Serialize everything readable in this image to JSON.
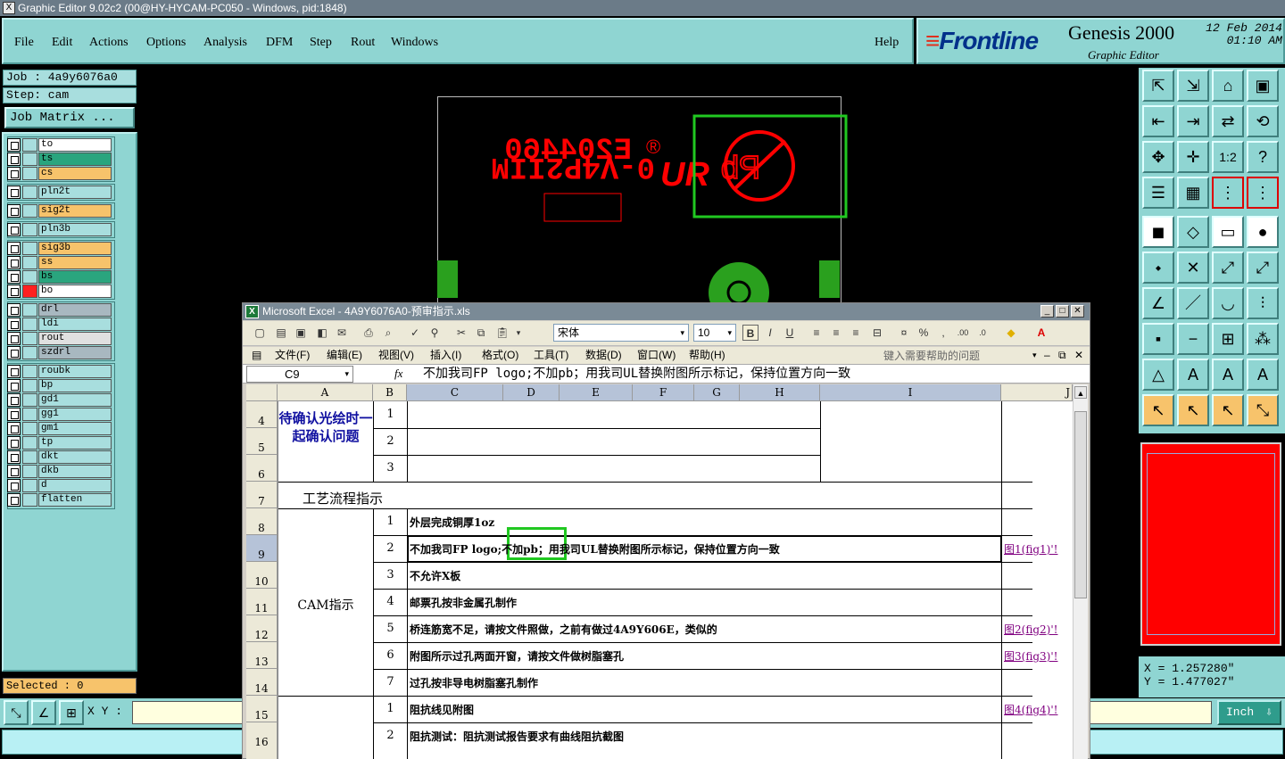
{
  "app_title": "Graphic Editor 9.02c2 (00@HY-HYCAM-PC050 - Windows, pid:1848)",
  "menu": [
    "File",
    "Edit",
    "Actions",
    "Options",
    "Analysis",
    "DFM",
    "Step",
    "Rout",
    "Windows"
  ],
  "help": "Help",
  "brand": {
    "logo": "Frontline",
    "product": "Genesis 2000",
    "subtitle": "Graphic Editor",
    "date": "12 Feb 2014",
    "time": "01:10 AM"
  },
  "job": "Job : 4a9y6076a0",
  "step": "Step: cam",
  "job_matrix": "Job Matrix ...",
  "layers": [
    {
      "name": "to",
      "color": "#ffffff",
      "group": 0
    },
    {
      "name": "ts",
      "color": "#2aa57e",
      "group": 0
    },
    {
      "name": "cs",
      "color": "#f7c36b",
      "group": 0
    },
    {
      "name": "pln2t",
      "color": "#a8dede",
      "group": 1
    },
    {
      "name": "sig2t",
      "color": "#f7c36b",
      "group": 2
    },
    {
      "name": "pln3b",
      "color": "#a8dede",
      "group": 3
    },
    {
      "name": "sig3b",
      "color": "#f7c36b",
      "group": 4
    },
    {
      "name": "ss",
      "color": "#f7c36b",
      "group": 4
    },
    {
      "name": "bs",
      "color": "#2aa57e",
      "group": 4
    },
    {
      "name": "bo",
      "color": "#ffffff",
      "group": 4
    },
    {
      "name": "drl",
      "color": "#a8b8c0",
      "group": 5
    },
    {
      "name": "ldi",
      "color": "#a8dede",
      "group": 5
    },
    {
      "name": "rout",
      "color": "#e0e0e0",
      "group": 5
    },
    {
      "name": "szdrl",
      "color": "#a8b8c0",
      "group": 5
    },
    {
      "name": "roubk",
      "color": "#a8dede",
      "group": 6
    },
    {
      "name": "bp",
      "color": "#a8dede",
      "group": 6
    },
    {
      "name": "gd1",
      "color": "#a8dede",
      "group": 6
    },
    {
      "name": "gg1",
      "color": "#a8dede",
      "group": 6
    },
    {
      "name": "gm1",
      "color": "#a8dede",
      "group": 6
    },
    {
      "name": "tp",
      "color": "#a8dede",
      "group": 6
    },
    {
      "name": "dkt",
      "color": "#a8dede",
      "group": 6
    },
    {
      "name": "dkb",
      "color": "#a8dede",
      "group": 6
    },
    {
      "name": "d",
      "color": "#a8dede",
      "group": 6
    },
    {
      "name": "flatten",
      "color": "#a8dede",
      "group": 6
    }
  ],
  "selected": "Selected : 0",
  "xy_label": "X Y :",
  "units": "Inch",
  "coords": {
    "x": "X = 1.257280\"",
    "y": "Y = 1.477027\""
  },
  "pcb": {
    "line1": "E204460",
    "line2": "0-V4P2IIM",
    "mark": "UR",
    "reg": "®",
    "pb": "Pb"
  },
  "excel": {
    "title": "Microsoft Excel - 4A9Y6076A0-预审指示.xls",
    "font": "宋体",
    "size": "10",
    "menu": [
      "文件(F)",
      "编辑(E)",
      "视图(V)",
      "插入(I)",
      "格式(O)",
      "工具(T)",
      "数据(D)",
      "窗口(W)",
      "帮助(H)"
    ],
    "ask": "键入需要帮助的问题",
    "namebox": "C9",
    "fx": "fx",
    "formula": "不加我司FP logo;不加pb；用我司UL替换附图所示标记，保持位置方向一致",
    "cols": [
      "A",
      "B",
      "C",
      "D",
      "E",
      "F",
      "G",
      "H",
      "I",
      "J"
    ],
    "rows": [
      "4",
      "5",
      "6",
      "7",
      "8",
      "9",
      "10",
      "11",
      "12",
      "13",
      "14",
      "15",
      "16"
    ],
    "confirm": "待确认光绘时一起确认问题",
    "process": "工艺流程指示",
    "cam": "CAM指示",
    "nums": [
      "1",
      "2",
      "3",
      "1",
      "2",
      "3",
      "4",
      "5",
      "6",
      "7",
      "1",
      "2"
    ],
    "items": [
      "外层完成铜厚1oz",
      "不加我司FP logo;不加pb；用我司UL替换附图所示标记，保持位置方向一致",
      "不允许X板",
      "邮票孔按非金属孔制作",
      "桥连筋宽不足，请按文件照做，之前有做过4A9Y606E，类似的",
      "附图所示过孔两面开窗，请按文件做树脂塞孔",
      "过孔按非导电树脂塞孔制作",
      "阻抗线见附图",
      "阻抗测试：阻抗测试报告要求有曲线阻抗截图"
    ],
    "links": [
      "图1(fig1)'!",
      "图2(fig2)'!",
      "图3(fig3)'!",
      "图4(fig4)'!"
    ]
  }
}
